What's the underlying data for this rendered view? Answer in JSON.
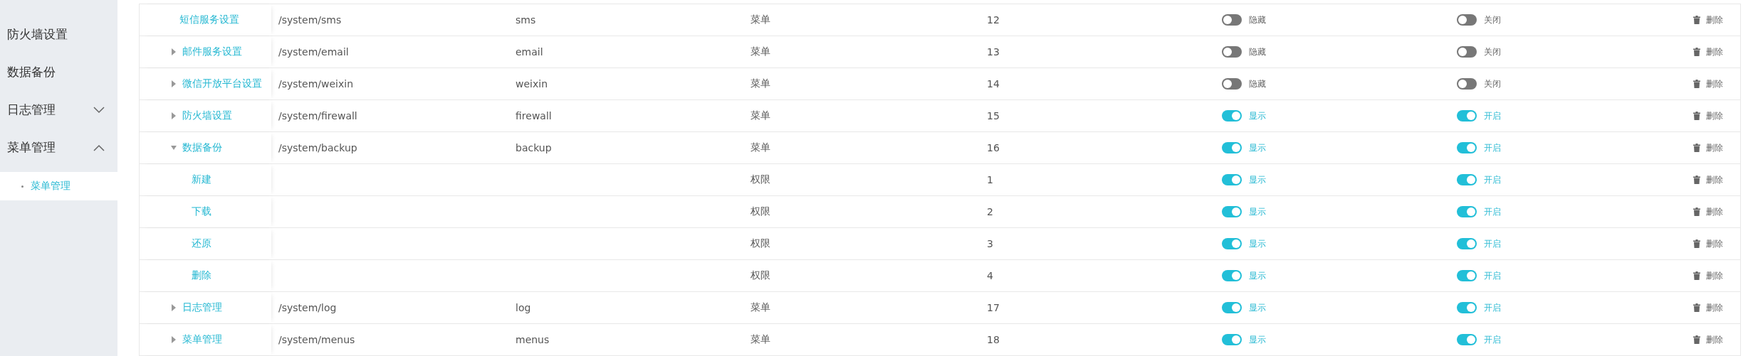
{
  "sidebar": {
    "items": [
      {
        "label": "防火墙设置",
        "kind": "link"
      },
      {
        "label": "数据备份",
        "kind": "link"
      },
      {
        "label": "日志管理",
        "kind": "group",
        "expanded": false
      },
      {
        "label": "菜单管理",
        "kind": "group",
        "expanded": true,
        "children": [
          {
            "label": "菜单管理",
            "selected": true
          }
        ]
      }
    ]
  },
  "table": {
    "rows": [
      {
        "name": "短信服务设置",
        "kind": "leaf",
        "path": "/system/sms",
        "component": "sms",
        "type": "菜单",
        "order": "12",
        "visible": false,
        "visible_label": "隐藏",
        "enabled": false,
        "enabled_label": "关闭",
        "action": "删除"
      },
      {
        "name": "邮件服务设置",
        "kind": "group",
        "expanded": false,
        "path": "/system/email",
        "component": "email",
        "type": "菜单",
        "order": "13",
        "visible": false,
        "visible_label": "隐藏",
        "enabled": false,
        "enabled_label": "关闭",
        "action": "删除"
      },
      {
        "name": "微信开放平台设置",
        "kind": "group",
        "expanded": false,
        "path": "/system/weixin",
        "component": "weixin",
        "type": "菜单",
        "order": "14",
        "visible": false,
        "visible_label": "隐藏",
        "enabled": false,
        "enabled_label": "关闭",
        "action": "删除"
      },
      {
        "name": "防火墙设置",
        "kind": "group",
        "expanded": false,
        "path": "/system/firewall",
        "component": "firewall",
        "type": "菜单",
        "order": "15",
        "visible": true,
        "visible_label": "显示",
        "enabled": true,
        "enabled_label": "开启",
        "action": "删除"
      },
      {
        "name": "数据备份",
        "kind": "group",
        "expanded": true,
        "path": "/system/backup",
        "component": "backup",
        "type": "菜单",
        "order": "16",
        "visible": true,
        "visible_label": "显示",
        "enabled": true,
        "enabled_label": "开启",
        "action": "删除",
        "children": [
          {
            "name": "新建",
            "type": "权限",
            "order": "1",
            "visible": true,
            "visible_label": "显示",
            "enabled": true,
            "enabled_label": "开启",
            "action": "删除"
          },
          {
            "name": "下载",
            "type": "权限",
            "order": "2",
            "visible": true,
            "visible_label": "显示",
            "enabled": true,
            "enabled_label": "开启",
            "action": "删除"
          },
          {
            "name": "还原",
            "type": "权限",
            "order": "3",
            "visible": true,
            "visible_label": "显示",
            "enabled": true,
            "enabled_label": "开启",
            "action": "删除"
          },
          {
            "name": "删除",
            "type": "权限",
            "order": "4",
            "visible": true,
            "visible_label": "显示",
            "enabled": true,
            "enabled_label": "开启",
            "action": "删除"
          }
        ]
      },
      {
        "name": "日志管理",
        "kind": "group",
        "expanded": false,
        "path": "/system/log",
        "component": "log",
        "type": "菜单",
        "order": "17",
        "visible": true,
        "visible_label": "显示",
        "enabled": true,
        "enabled_label": "开启",
        "action": "删除"
      },
      {
        "name": "菜单管理",
        "kind": "group",
        "expanded": false,
        "path": "/system/menus",
        "component": "menus",
        "type": "菜单",
        "order": "18",
        "visible": true,
        "visible_label": "显示",
        "enabled": true,
        "enabled_label": "开启",
        "action": "删除"
      }
    ]
  }
}
